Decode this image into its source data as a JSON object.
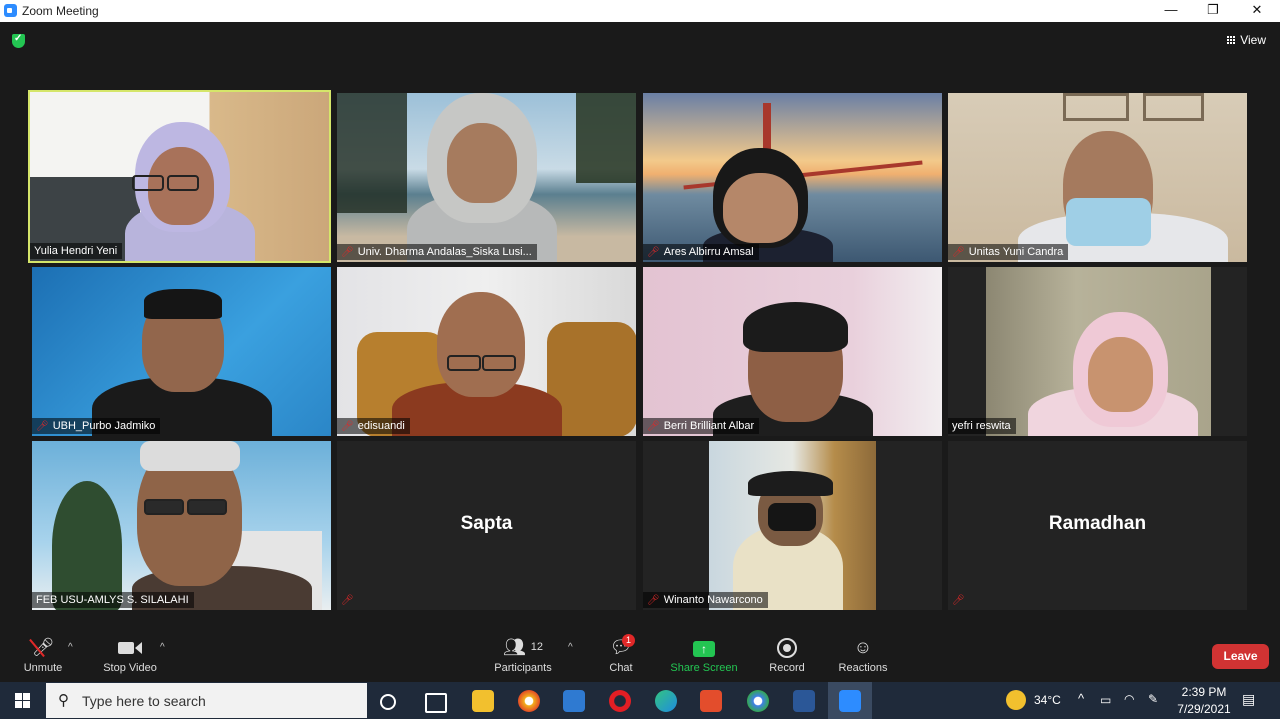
{
  "window": {
    "title": "Zoom Meeting",
    "controls": [
      "—",
      "❐",
      "✕"
    ]
  },
  "stage": {
    "view_label": "View"
  },
  "participants": [
    {
      "name": "Yulia Hendri Yeni",
      "video": true,
      "muted": false,
      "active": true
    },
    {
      "name": "Univ. Dharma Andalas_Siska Lusi...",
      "video": true,
      "muted": true
    },
    {
      "name": "Ares Albirru Amsal",
      "video": true,
      "muted": true
    },
    {
      "name": "Unitas Yuni Candra",
      "video": true,
      "muted": true
    },
    {
      "name": "UBH_Purbo Jadmiko",
      "video": true,
      "muted": true
    },
    {
      "name": "edisuandi",
      "video": true,
      "muted": true
    },
    {
      "name": "Berri Brilliant Albar",
      "video": true,
      "muted": true
    },
    {
      "name": "yefri reswita",
      "video": true,
      "muted": false
    },
    {
      "name": "FEB USU-AMLYS S. SILALAHI",
      "video": true,
      "muted": false
    },
    {
      "name": "Sapta",
      "video": false,
      "muted": true
    },
    {
      "name": "Winanto Nawarcono",
      "video": true,
      "muted": true
    },
    {
      "name": "Ramadhan",
      "video": false,
      "muted": true
    }
  ],
  "toolbar": {
    "unmute": "Unmute",
    "stop_video": "Stop Video",
    "participants": "Participants",
    "participants_count": "12",
    "chat": "Chat",
    "chat_badge": "1",
    "share_screen": "Share Screen",
    "record": "Record",
    "reactions": "Reactions",
    "leave": "Leave",
    "share_color": "#23c552",
    "leave_color": "#d13333"
  },
  "taskbar": {
    "search_placeholder": "Type here to search",
    "weather": "34°C",
    "time": "2:39 PM",
    "date": "7/29/2021",
    "apps": [
      "task-view-icon",
      "file-explorer-icon",
      "chrome-icon",
      "store-icon",
      "opera-icon",
      "edge-icon",
      "office-icon",
      "chrome-alt-icon",
      "word-icon",
      "zoom-icon"
    ]
  }
}
